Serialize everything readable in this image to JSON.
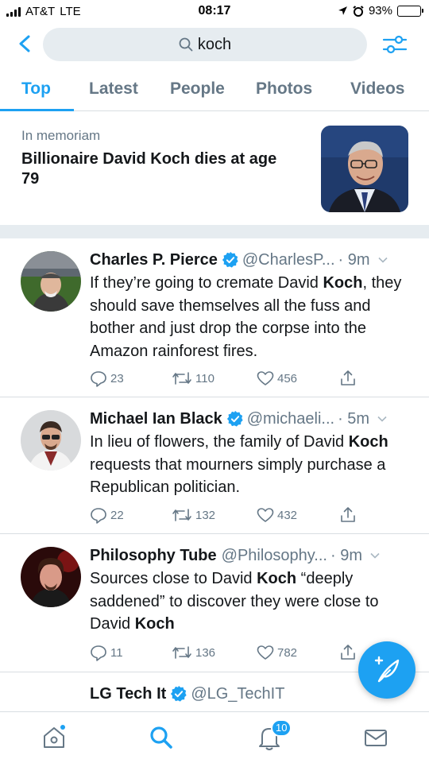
{
  "status": {
    "carrier": "AT&T",
    "network": "LTE",
    "time": "08:17",
    "battery": "93%",
    "battery_level": 0.93
  },
  "search": {
    "query": "koch"
  },
  "tabs": [
    {
      "label": "Top",
      "active": true
    },
    {
      "label": "Latest"
    },
    {
      "label": "People"
    },
    {
      "label": "Photos"
    },
    {
      "label": "Videos"
    }
  ],
  "news": {
    "kicker": "In memoriam",
    "title": "Billionaire David Koch dies at age 79"
  },
  "tweets": [
    {
      "name": "Charles P. Pierce",
      "handle": "@CharlesP...",
      "time": "· 9m",
      "body_parts": [
        "If they’re going to cremate David ",
        "Koch",
        ", they should save themselves all the fuss and bother and just drop the corpse into the Amazon rainforest fires."
      ],
      "replies": "23",
      "retweets": "110",
      "likes": "456"
    },
    {
      "name": "Michael Ian Black",
      "handle": "@michaeli...",
      "time": "· 5m",
      "body_parts": [
        "In lieu of flowers, the family of David ",
        "Koch",
        " requests that mourners simply purchase a Republican politician."
      ],
      "replies": "22",
      "retweets": "132",
      "likes": "432"
    },
    {
      "name": "Philosophy Tube",
      "handle": "@Philosophy...",
      "time": "· 9m",
      "body_parts": [
        "Sources close to David ",
        "Koch",
        " “deeply saddened” to discover they were close to David ",
        "Koch"
      ],
      "replies": "11",
      "retweets": "136",
      "likes": "782"
    },
    {
      "name": "LG Tech It",
      "handle": "@LG_TechIT",
      "time": ""
    }
  ],
  "tabbar": {
    "notifications_badge": "10"
  },
  "colors": {
    "accent": "#1da1f2",
    "secondary_text": "#657786",
    "divider": "#e6ecf0"
  }
}
